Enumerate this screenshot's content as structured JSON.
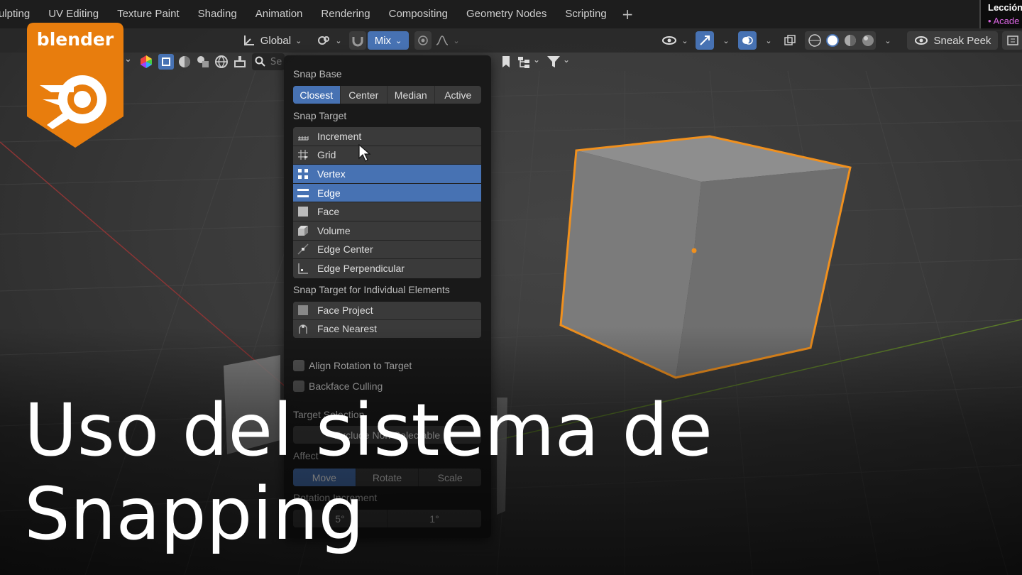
{
  "workspace_tabs": [
    "ulpting",
    "UV Editing",
    "Texture Paint",
    "Shading",
    "Animation",
    "Rendering",
    "Compositing",
    "Geometry Nodes",
    "Scripting"
  ],
  "add_workspace_symbol": "+",
  "lesson_badge": {
    "line1": "Lección",
    "line2": "• Acade"
  },
  "logo": {
    "text": "blender",
    "color": "#e87d0d"
  },
  "header": {
    "orientation": "Global",
    "snap_mode": "Mix",
    "sneak_peek": "Sneak Peek",
    "search_placeholder": "Se"
  },
  "snap_panel": {
    "snap_base_label": "Snap Base",
    "snap_base_options": [
      {
        "label": "Closest",
        "active": true
      },
      {
        "label": "Center",
        "active": false
      },
      {
        "label": "Median",
        "active": false
      },
      {
        "label": "Active",
        "active": false
      }
    ],
    "snap_target_label": "Snap Target",
    "snap_targets": [
      {
        "label": "Increment",
        "active": false,
        "icon": "increment-icon"
      },
      {
        "label": "Grid",
        "active": false,
        "icon": "grid-icon"
      },
      {
        "label": "Vertex",
        "active": true,
        "icon": "vertex-icon"
      },
      {
        "label": "Edge",
        "active": true,
        "icon": "edge-icon"
      },
      {
        "label": "Face",
        "active": false,
        "icon": "face-icon"
      },
      {
        "label": "Volume",
        "active": false,
        "icon": "volume-icon"
      },
      {
        "label": "Edge Center",
        "active": false,
        "icon": "edge-center-icon"
      },
      {
        "label": "Edge Perpendicular",
        "active": false,
        "icon": "edge-perpendicular-icon"
      }
    ],
    "individual_label": "Snap Target for Individual Elements",
    "individual_targets": [
      {
        "label": "Face Project",
        "icon": "face-project-icon"
      },
      {
        "label": "Face Nearest",
        "icon": "face-nearest-icon"
      }
    ],
    "align_rotation": "Align Rotation to Target",
    "backface_culling": "Backface Culling",
    "target_selection_label": "Target Selection",
    "target_selection_value": "Exclude Non-Selectable",
    "affect_label": "Affect",
    "affect_options": [
      {
        "label": "Move",
        "active": true
      },
      {
        "label": "Rotate",
        "active": false
      },
      {
        "label": "Scale",
        "active": false
      }
    ],
    "rotation_increment_label": "Rotation Increment",
    "rotation_increment_values": [
      "5°",
      "1°"
    ]
  },
  "title": {
    "line1": "Uso del sistema de",
    "line2": "Snapping"
  },
  "colors": {
    "accent": "#4772b3",
    "selection_outline": "#f0901e",
    "brand": "#e87d0d"
  }
}
